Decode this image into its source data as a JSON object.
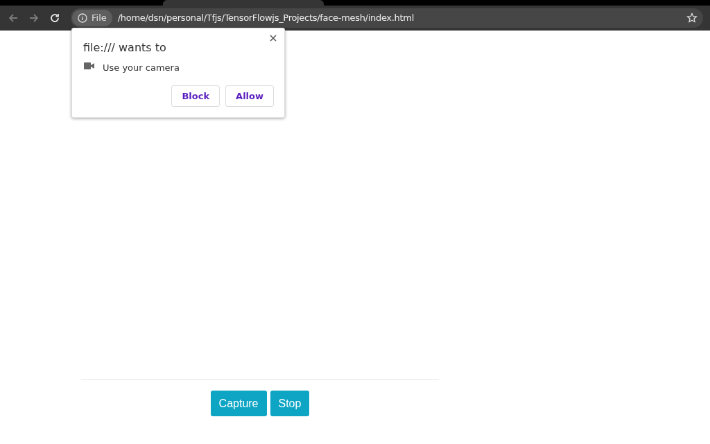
{
  "address_bar": {
    "chip": "File",
    "url": "/home/dsn/personal/Tfjs/TensorFlowjs_Projects/face-mesh/index.html"
  },
  "permission_prompt": {
    "title": "file:/// wants to",
    "request": "Use your camera",
    "buttons": [
      "Block",
      "Allow"
    ]
  },
  "page": {
    "buttons": [
      "Capture",
      "Stop"
    ]
  }
}
